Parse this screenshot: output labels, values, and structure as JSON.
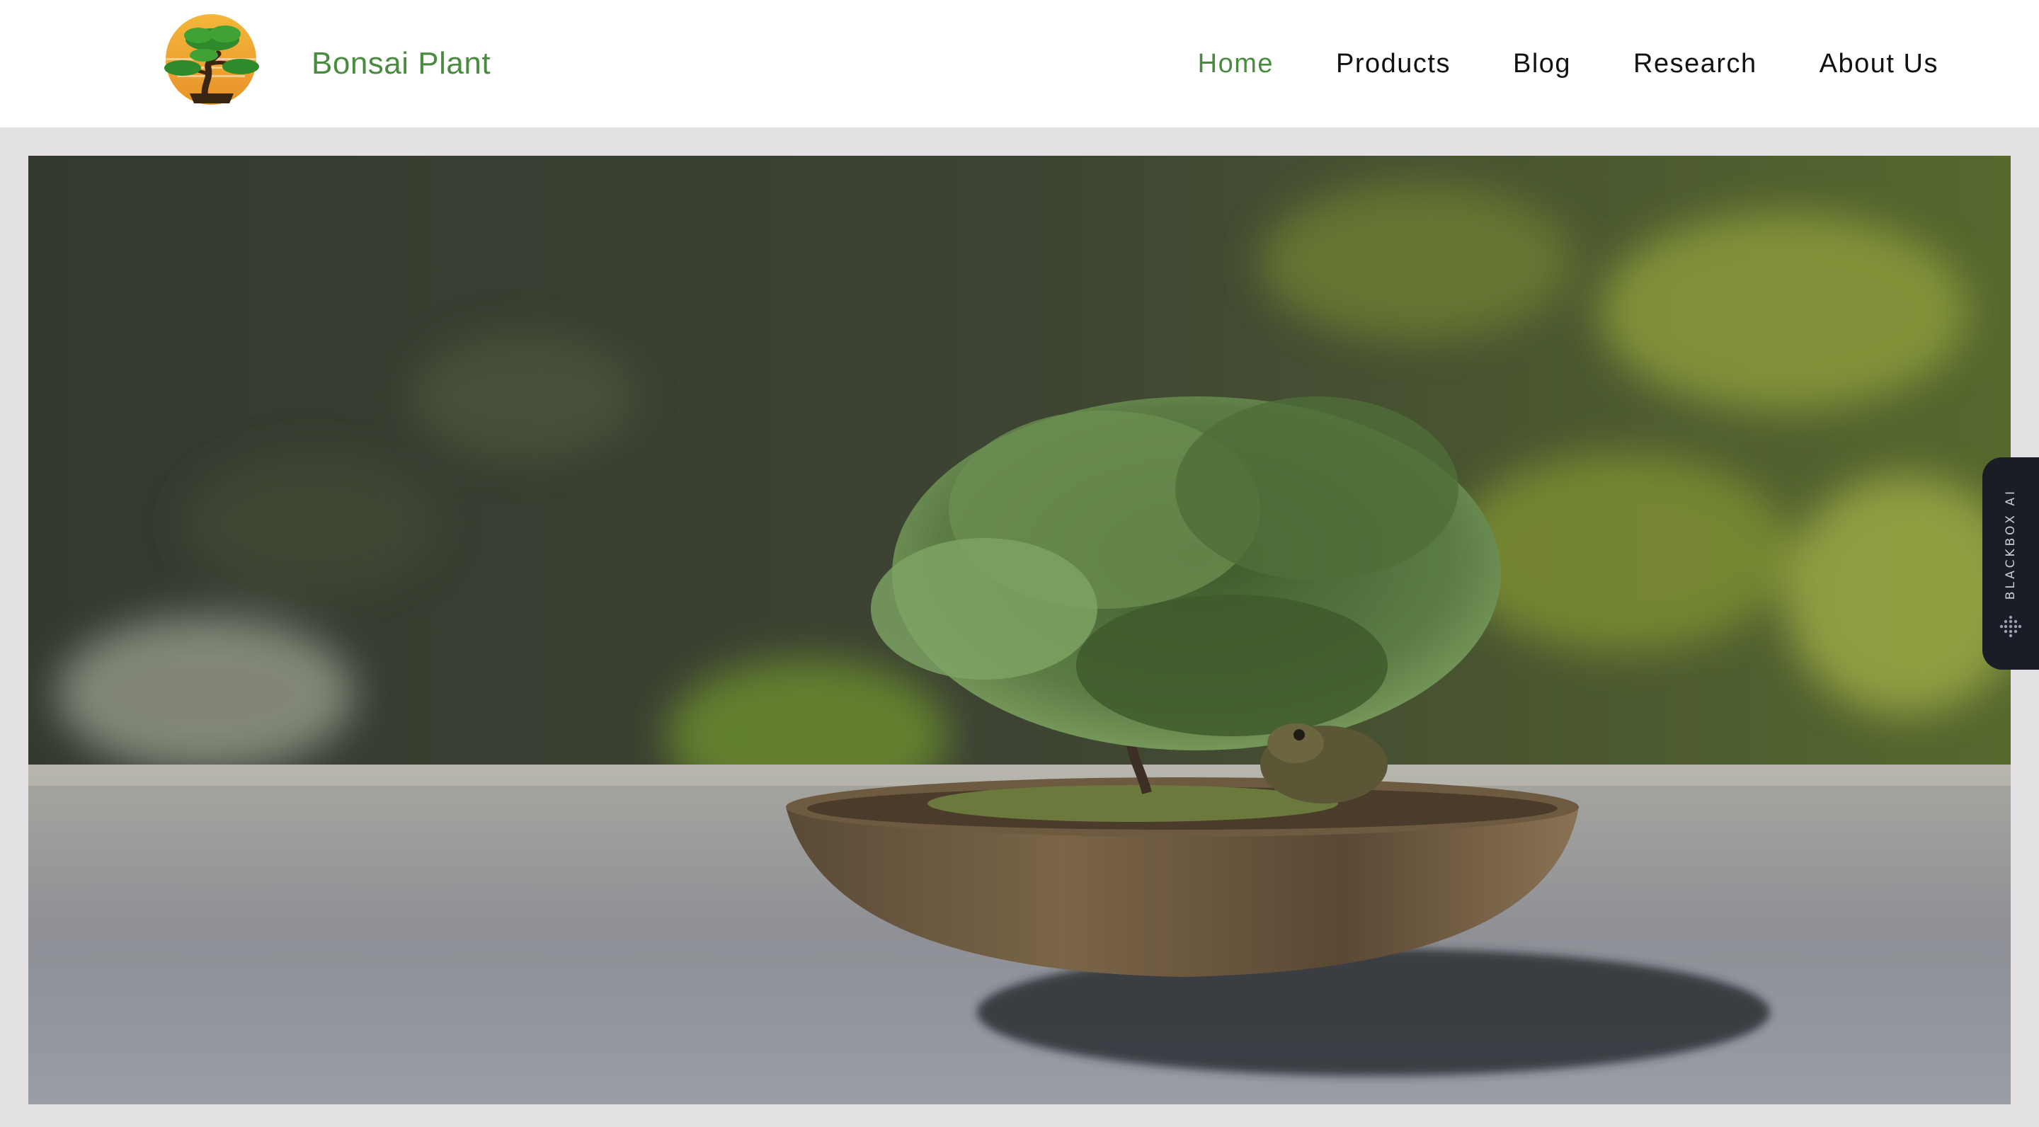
{
  "brand": {
    "name": "Bonsai Plant",
    "logo": "bonsai-tree-logo"
  },
  "nav": {
    "items": [
      {
        "label": "Home",
        "active": true
      },
      {
        "label": "Products",
        "active": false
      },
      {
        "label": "Blog",
        "active": false
      },
      {
        "label": "Research",
        "active": false
      },
      {
        "label": "About Us",
        "active": false
      }
    ]
  },
  "hero": {
    "image": "bonsai-tree-in-wooden-bowl-with-frog-photo"
  },
  "side_tab": {
    "label": "BLACKBOX AI",
    "icon": "dot-grid-icon"
  },
  "colors": {
    "accent": "#4a8c3f",
    "text": "#111111",
    "page_bg": "#e3e1e3",
    "side_tab_bg": "#1a1c26"
  }
}
